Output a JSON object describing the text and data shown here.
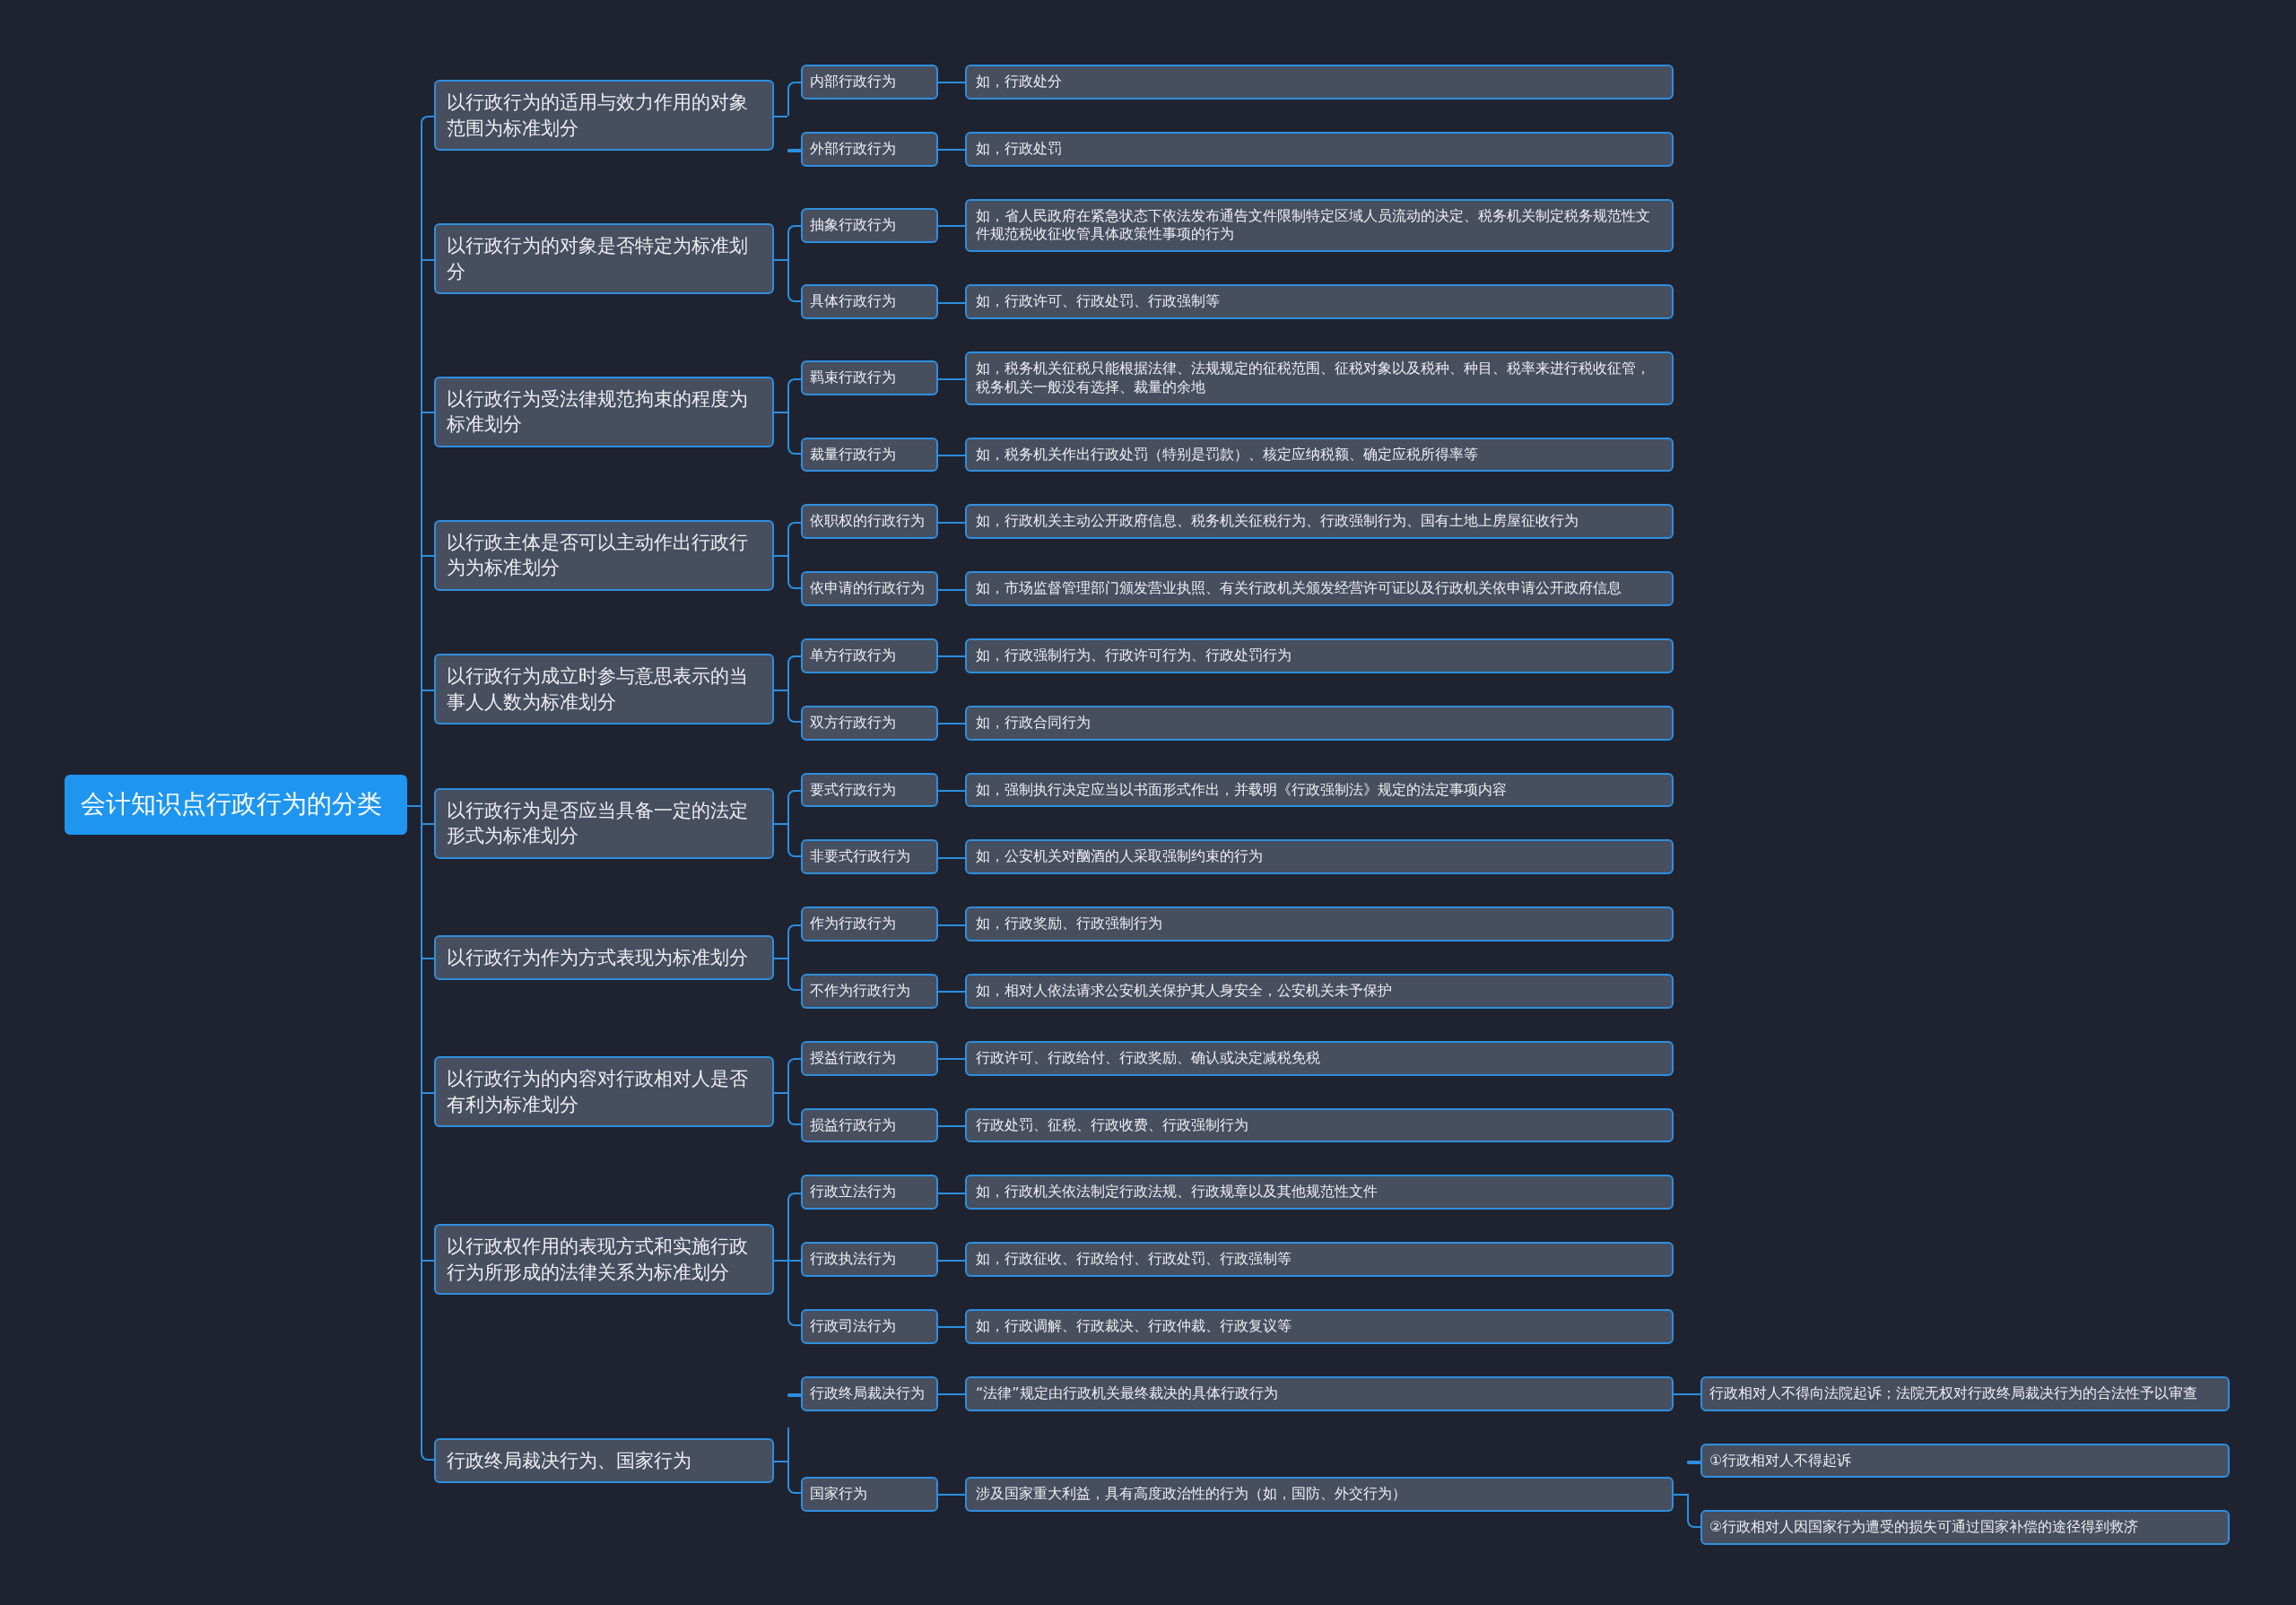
{
  "root": {
    "label": "会计知识点行政行为的分类"
  },
  "branches": [
    {
      "label": "以行政行为的适用与效力作用的对象范围为标准划分",
      "children": [
        {
          "label": "内部行政行为",
          "children": [
            {
              "label": "如，行政处分"
            }
          ]
        },
        {
          "label": "外部行政行为",
          "children": [
            {
              "label": "如，行政处罚"
            }
          ]
        }
      ]
    },
    {
      "label": "以行政行为的对象是否特定为标准划分",
      "children": [
        {
          "label": "抽象行政行为",
          "children": [
            {
              "label": "如，省人民政府在紧急状态下依法发布通告文件限制特定区域人员流动的决定、税务机关制定税务规范性文件规范税收征收管具体政策性事项的行为"
            }
          ]
        },
        {
          "label": "具体行政行为",
          "children": [
            {
              "label": "如，行政许可、行政处罚、行政强制等"
            }
          ]
        }
      ]
    },
    {
      "label": "以行政行为受法律规范拘束的程度为标准划分",
      "children": [
        {
          "label": "羁束行政行为",
          "children": [
            {
              "label": "如，税务机关征税只能根据法律、法规规定的征税范围、征税对象以及税种、种目、税率来进行税收征管，税务机关一般没有选择、裁量的余地"
            }
          ]
        },
        {
          "label": "裁量行政行为",
          "children": [
            {
              "label": "如，税务机关作出行政处罚（特别是罚款）、核定应纳税额、确定应税所得率等"
            }
          ]
        }
      ]
    },
    {
      "label": "以行政主体是否可以主动作出行政行为为标准划分",
      "children": [
        {
          "label": "依职权的行政行为",
          "children": [
            {
              "label": "如，行政机关主动公开政府信息、税务机关征税行为、行政强制行为、国有土地上房屋征收行为"
            }
          ]
        },
        {
          "label": "依申请的行政行为",
          "children": [
            {
              "label": "如，市场监督管理部门颁发营业执照、有关行政机关颁发经营许可证以及行政机关依申请公开政府信息"
            }
          ]
        }
      ]
    },
    {
      "label": "以行政行为成立时参与意思表示的当事人人数为标准划分",
      "children": [
        {
          "label": "单方行政行为",
          "children": [
            {
              "label": "如，行政强制行为、行政许可行为、行政处罚行为"
            }
          ]
        },
        {
          "label": "双方行政行为",
          "children": [
            {
              "label": "如，行政合同行为"
            }
          ]
        }
      ]
    },
    {
      "label": "以行政行为是否应当具备一定的法定形式为标准划分",
      "children": [
        {
          "label": "要式行政行为",
          "children": [
            {
              "label": "如，强制执行决定应当以书面形式作出，并载明《行政强制法》规定的法定事项内容"
            }
          ]
        },
        {
          "label": "非要式行政行为",
          "children": [
            {
              "label": "如，公安机关对酗酒的人采取强制约束的行为"
            }
          ]
        }
      ]
    },
    {
      "label": "以行政行为作为方式表现为标准划分",
      "children": [
        {
          "label": "作为行政行为",
          "children": [
            {
              "label": "如，行政奖励、行政强制行为"
            }
          ]
        },
        {
          "label": "不作为行政行为",
          "children": [
            {
              "label": "如，相对人依法请求公安机关保护其人身安全，公安机关未予保护"
            }
          ]
        }
      ]
    },
    {
      "label": "以行政行为的内容对行政相对人是否有利为标准划分",
      "children": [
        {
          "label": "授益行政行为",
          "children": [
            {
              "label": "行政许可、行政给付、行政奖励、确认或决定减税免税"
            }
          ]
        },
        {
          "label": "损益行政行为",
          "children": [
            {
              "label": "行政处罚、征税、行政收费、行政强制行为"
            }
          ]
        }
      ]
    },
    {
      "label": "以行政权作用的表现方式和实施行政行为所形成的法律关系为标准划分",
      "children": [
        {
          "label": "行政立法行为",
          "children": [
            {
              "label": "如，行政机关依法制定行政法规、行政规章以及其他规范性文件"
            }
          ]
        },
        {
          "label": "行政执法行为",
          "children": [
            {
              "label": "如，行政征收、行政给付、行政处罚、行政强制等"
            }
          ]
        },
        {
          "label": "行政司法行为",
          "children": [
            {
              "label": "如，行政调解、行政裁决、行政仲裁、行政复议等"
            }
          ]
        }
      ]
    },
    {
      "label": "行政终局裁决行为、国家行为",
      "children": [
        {
          "label": "行政终局裁决行为",
          "children": [
            {
              "label": "“法律”规定由行政机关最终裁决的具体行政行为",
              "children": [
                {
                  "label": "行政相对人不得向法院起诉；法院无权对行政终局裁决行为的合法性予以审查"
                }
              ]
            }
          ]
        },
        {
          "label": "国家行为",
          "children": [
            {
              "label": "涉及国家重大利益，具有高度政治性的行为（如，国防、外交行为）",
              "children": [
                {
                  "label": "①行政相对人不得起诉"
                },
                {
                  "label": "②行政相对人因国家行为遭受的损失可通过国家补偿的途径得到救济"
                }
              ]
            }
          ]
        }
      ]
    }
  ]
}
